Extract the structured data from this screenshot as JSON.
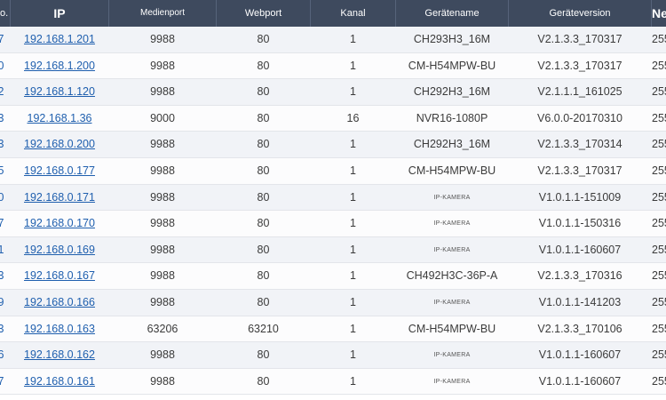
{
  "header": {
    "col_no": "o.",
    "col_ip": "IP",
    "col_media_port": "Medienport",
    "col_web_port": "Webport",
    "col_channel": "Kanal",
    "col_device_name": "Gerätename",
    "col_device_version": "Geräteversion",
    "col_netmask": "Ne"
  },
  "rows": [
    {
      "no": "7",
      "ip": "192.168.1.201",
      "media_port": "9988",
      "web_port": "80",
      "channel": "1",
      "device_name": "CH293H3_16M",
      "version": "V2.1.3.3_170317",
      "netmask": "255"
    },
    {
      "no": "0",
      "ip": "192.168.1.200",
      "media_port": "9988",
      "web_port": "80",
      "channel": "1",
      "device_name": "CM-H54MPW-BU",
      "version": "V2.1.3.3_170317",
      "netmask": "255"
    },
    {
      "no": "2",
      "ip": "192.168.1.120",
      "media_port": "9988",
      "web_port": "80",
      "channel": "1",
      "device_name": "CH292H3_16M",
      "version": "V2.1.1.1_161025",
      "netmask": "255"
    },
    {
      "no": "3",
      "ip": "192.168.1.36",
      "media_port": "9000",
      "web_port": "80",
      "channel": "16",
      "device_name": "NVR16-1080P",
      "version": "V6.0.0-20170310",
      "netmask": "255"
    },
    {
      "no": "3",
      "ip": "192.168.0.200",
      "media_port": "9988",
      "web_port": "80",
      "channel": "1",
      "device_name": "CH292H3_16M",
      "version": "V2.1.3.3_170314",
      "netmask": "255"
    },
    {
      "no": "5",
      "ip": "192.168.0.177",
      "media_port": "9988",
      "web_port": "80",
      "channel": "1",
      "device_name": "CM-H54MPW-BU",
      "version": "V2.1.3.3_170317",
      "netmask": "255"
    },
    {
      "no": "0",
      "ip": "192.168.0.171",
      "media_port": "9988",
      "web_port": "80",
      "channel": "1",
      "device_name": "IP-KAMERA",
      "version": "V1.0.1.1-151009",
      "netmask": "255"
    },
    {
      "no": "7",
      "ip": "192.168.0.170",
      "media_port": "9988",
      "web_port": "80",
      "channel": "1",
      "device_name": "IP-KAMERA",
      "version": "V1.0.1.1-150316",
      "netmask": "255"
    },
    {
      "no": "1",
      "ip": "192.168.0.169",
      "media_port": "9988",
      "web_port": "80",
      "channel": "1",
      "device_name": "IP-KAMERA",
      "version": "V1.0.1.1-160607",
      "netmask": "255"
    },
    {
      "no": "3",
      "ip": "192.168.0.167",
      "media_port": "9988",
      "web_port": "80",
      "channel": "1",
      "device_name": "CH492H3C-36P-A",
      "version": "V2.1.3.3_170316",
      "netmask": "255"
    },
    {
      "no": "9",
      "ip": "192.168.0.166",
      "media_port": "9988",
      "web_port": "80",
      "channel": "1",
      "device_name": "IP-KAMERA",
      "version": "V1.0.1.1-141203",
      "netmask": "255"
    },
    {
      "no": "3",
      "ip": "192.168.0.163",
      "media_port": "63206",
      "web_port": "63210",
      "channel": "1",
      "device_name": "CM-H54MPW-BU",
      "version": "V2.1.3.3_170106",
      "netmask": "255"
    },
    {
      "no": "6",
      "ip": "192.168.0.162",
      "media_port": "9988",
      "web_port": "80",
      "channel": "1",
      "device_name": "IP-KAMERA",
      "version": "V1.0.1.1-160607",
      "netmask": "255"
    },
    {
      "no": "7",
      "ip": "192.168.0.161",
      "media_port": "9988",
      "web_port": "80",
      "channel": "1",
      "device_name": "IP-KAMERA",
      "version": "V1.0.1.1-160607",
      "netmask": "255"
    }
  ]
}
